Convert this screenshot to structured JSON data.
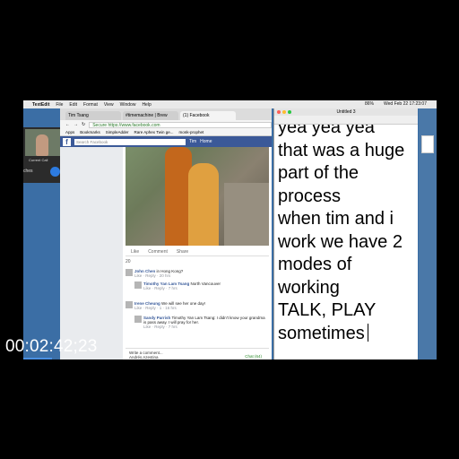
{
  "menubar": {
    "app_name": "TextEdit",
    "items": [
      "File",
      "Edit",
      "Format",
      "View",
      "Window",
      "Help"
    ],
    "clock": "Wed Feb 22 17:23:07",
    "battery": "86%"
  },
  "call": {
    "label": "Current Call",
    "side_label": "ches"
  },
  "browser": {
    "tabs": [
      "Tim Tsang",
      "#timemachine | Brew",
      "(1) Facebook"
    ],
    "url_secure": "Secure",
    "url": "https://www.facebook.com",
    "bookmarks": [
      "Apps",
      "Bookmarks",
      "SimpleAdder",
      "Rare Aphex Twin ge...",
      "monk-prophet"
    ],
    "fb_search_placeholder": "Search Facebook",
    "fb_user": "Tim",
    "fb_home": "Home"
  },
  "post": {
    "actions": [
      "Like",
      "Comment",
      "Share"
    ],
    "reaction_count": "20",
    "comments": [
      {
        "name": "John Chen",
        "text": "in Hong Kong?",
        "meta": "Like · Reply · 20 hrs"
      },
      {
        "name": "Timothy Yan Lam Tsang",
        "text": "North Vancouver",
        "meta": "Like · Reply · 7 hrs"
      },
      {
        "name": "Irene Cheung",
        "text": "We will see her one day!",
        "meta": "Like · Reply · 1 · 16 hrs"
      },
      {
        "name": "Sandy Parrish",
        "text": "Timothy Yan Lam Tsang: I didn't know your grandma is pass away. I will pray for her.",
        "meta": "Like · Reply · 7 hrs"
      }
    ],
    "write_comment": "Write a comment...",
    "chat_user": "Andrés Azestina",
    "chat_label": "Chat (64)"
  },
  "textedit": {
    "title": "Untitled 3",
    "lines": [
      "yea yea yea",
      "that was a huge",
      "part of the",
      "process",
      "when tim and i",
      "work we have 2",
      "modes of",
      "working",
      "TALK, PLAY",
      "sometimes"
    ]
  },
  "timecode": "00:02:42;23",
  "colors": {
    "facebook_blue": "#3b5998",
    "desktop_blue": "#3b6ea5",
    "call_hangup": "#e03a3a",
    "call_mic": "#2d7be0"
  }
}
